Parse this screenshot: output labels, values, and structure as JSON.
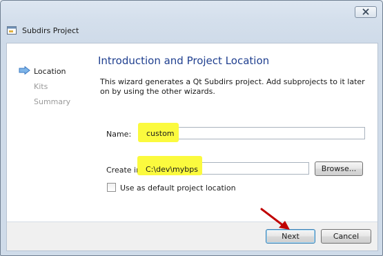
{
  "window": {
    "title": "Subdirs Project"
  },
  "sidebar": {
    "steps": [
      {
        "label": "Location",
        "state": "active"
      },
      {
        "label": "Kits",
        "state": "inactive"
      },
      {
        "label": "Summary",
        "state": "inactive"
      }
    ]
  },
  "page": {
    "title": "Introduction and Project Location",
    "description": "This wizard generates a Qt Subdirs project. Add subprojects to it later on by using the other wizards."
  },
  "form": {
    "name_label": "Name:",
    "name_value": "custom",
    "create_in_label": "Create in:",
    "create_in_value": "C:\\dev\\mybps",
    "browse_label": "Browse...",
    "default_location_label": "Use as default project location",
    "default_location_checked": false
  },
  "footer": {
    "next_label": "Next",
    "cancel_label": "Cancel"
  },
  "colors": {
    "highlight": "#fbfa3e",
    "title_blue": "#1f3f8f",
    "annotation_arrow": "#c00000"
  },
  "icons": {
    "window_icon": "window-icon",
    "step_arrow": "step-arrow-icon",
    "close": "close-icon",
    "annotation": "red-arrow-annotation-icon"
  }
}
